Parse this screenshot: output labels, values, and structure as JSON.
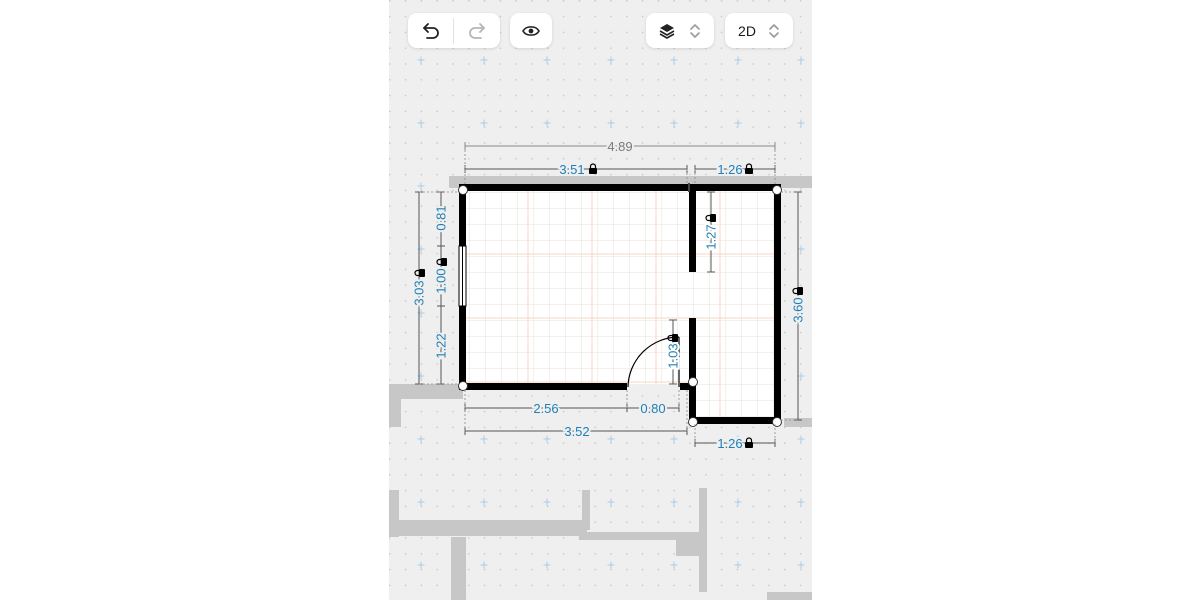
{
  "toolbar": {
    "undo_icon": "undo-arrow-icon",
    "redo_icon": "redo-arrow-icon",
    "preview_icon": "eye-icon",
    "layers_icon": "layers-icon",
    "stepper_icon": "chevron-up-down-icon",
    "view_mode": "2D"
  },
  "dimensions": {
    "overall_width": "4.89",
    "top_left_width": "3.51",
    "top_right_width": "1.26",
    "left_height": "3.03",
    "left_upper_segment": "0.81",
    "left_window": "1.00",
    "left_lower_segment": "1.22",
    "inner_wall_upper": "1.27",
    "inner_wall_door": "1.03",
    "right_height": "3.60",
    "bottom_left_segment": "2.56",
    "door_width": "0.80",
    "bottom_width": "3.52",
    "bottom_right_width": "1.26"
  },
  "colors": {
    "canvas_background": "#efefef",
    "measurement_blue": "#1f7fb6",
    "overall_measurement_gray": "#7a7a7a",
    "wall": "#000000",
    "floor_grid": "#f7c7b0",
    "neighbor_walls": "#c7c7c7"
  }
}
